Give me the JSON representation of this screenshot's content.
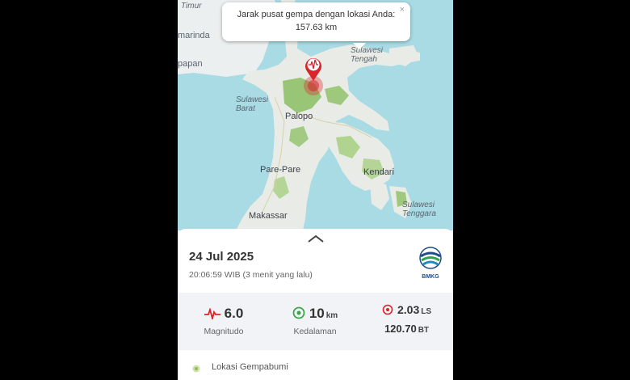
{
  "map": {
    "labels": {
      "timur": "Timur",
      "kalimantan": "marinda",
      "papan": "papan",
      "sulteng_1": "Sulawesi",
      "sulteng_2": "Tengah",
      "sulbar_1": "Sulawesi",
      "sulbar_2": "Barat",
      "sultra_1": "Sulawesi",
      "sultra_2": "Tenggara"
    },
    "cities": {
      "palopo": "Palopo",
      "parepare": "Pare-Pare",
      "kendari": "Kendari",
      "makassar": "Makassar"
    }
  },
  "popup": {
    "line1": "Jarak pusat gempa dengan lokasi Anda:",
    "line2": "157.63 km",
    "close": "×"
  },
  "event": {
    "date": "24 Jul 2025",
    "time": "20:06:59 WIB",
    "ago": "(3 menit yang lalu)"
  },
  "logo": {
    "text": "BMKG"
  },
  "stats": {
    "magnitude": {
      "value": "6.0",
      "label": "Magnitudo"
    },
    "depth": {
      "value": "10",
      "unit": "km",
      "label": "Kedalaman"
    },
    "coords": {
      "lat": "2.03",
      "lat_unit": "LS",
      "lon": "120.70",
      "lon_unit": "BT"
    }
  },
  "location": {
    "label": "Lokasi Gempabumi"
  },
  "colors": {
    "accent": "#d9242b",
    "depth": "#3aa64a",
    "brand": "#1f4e8c"
  }
}
